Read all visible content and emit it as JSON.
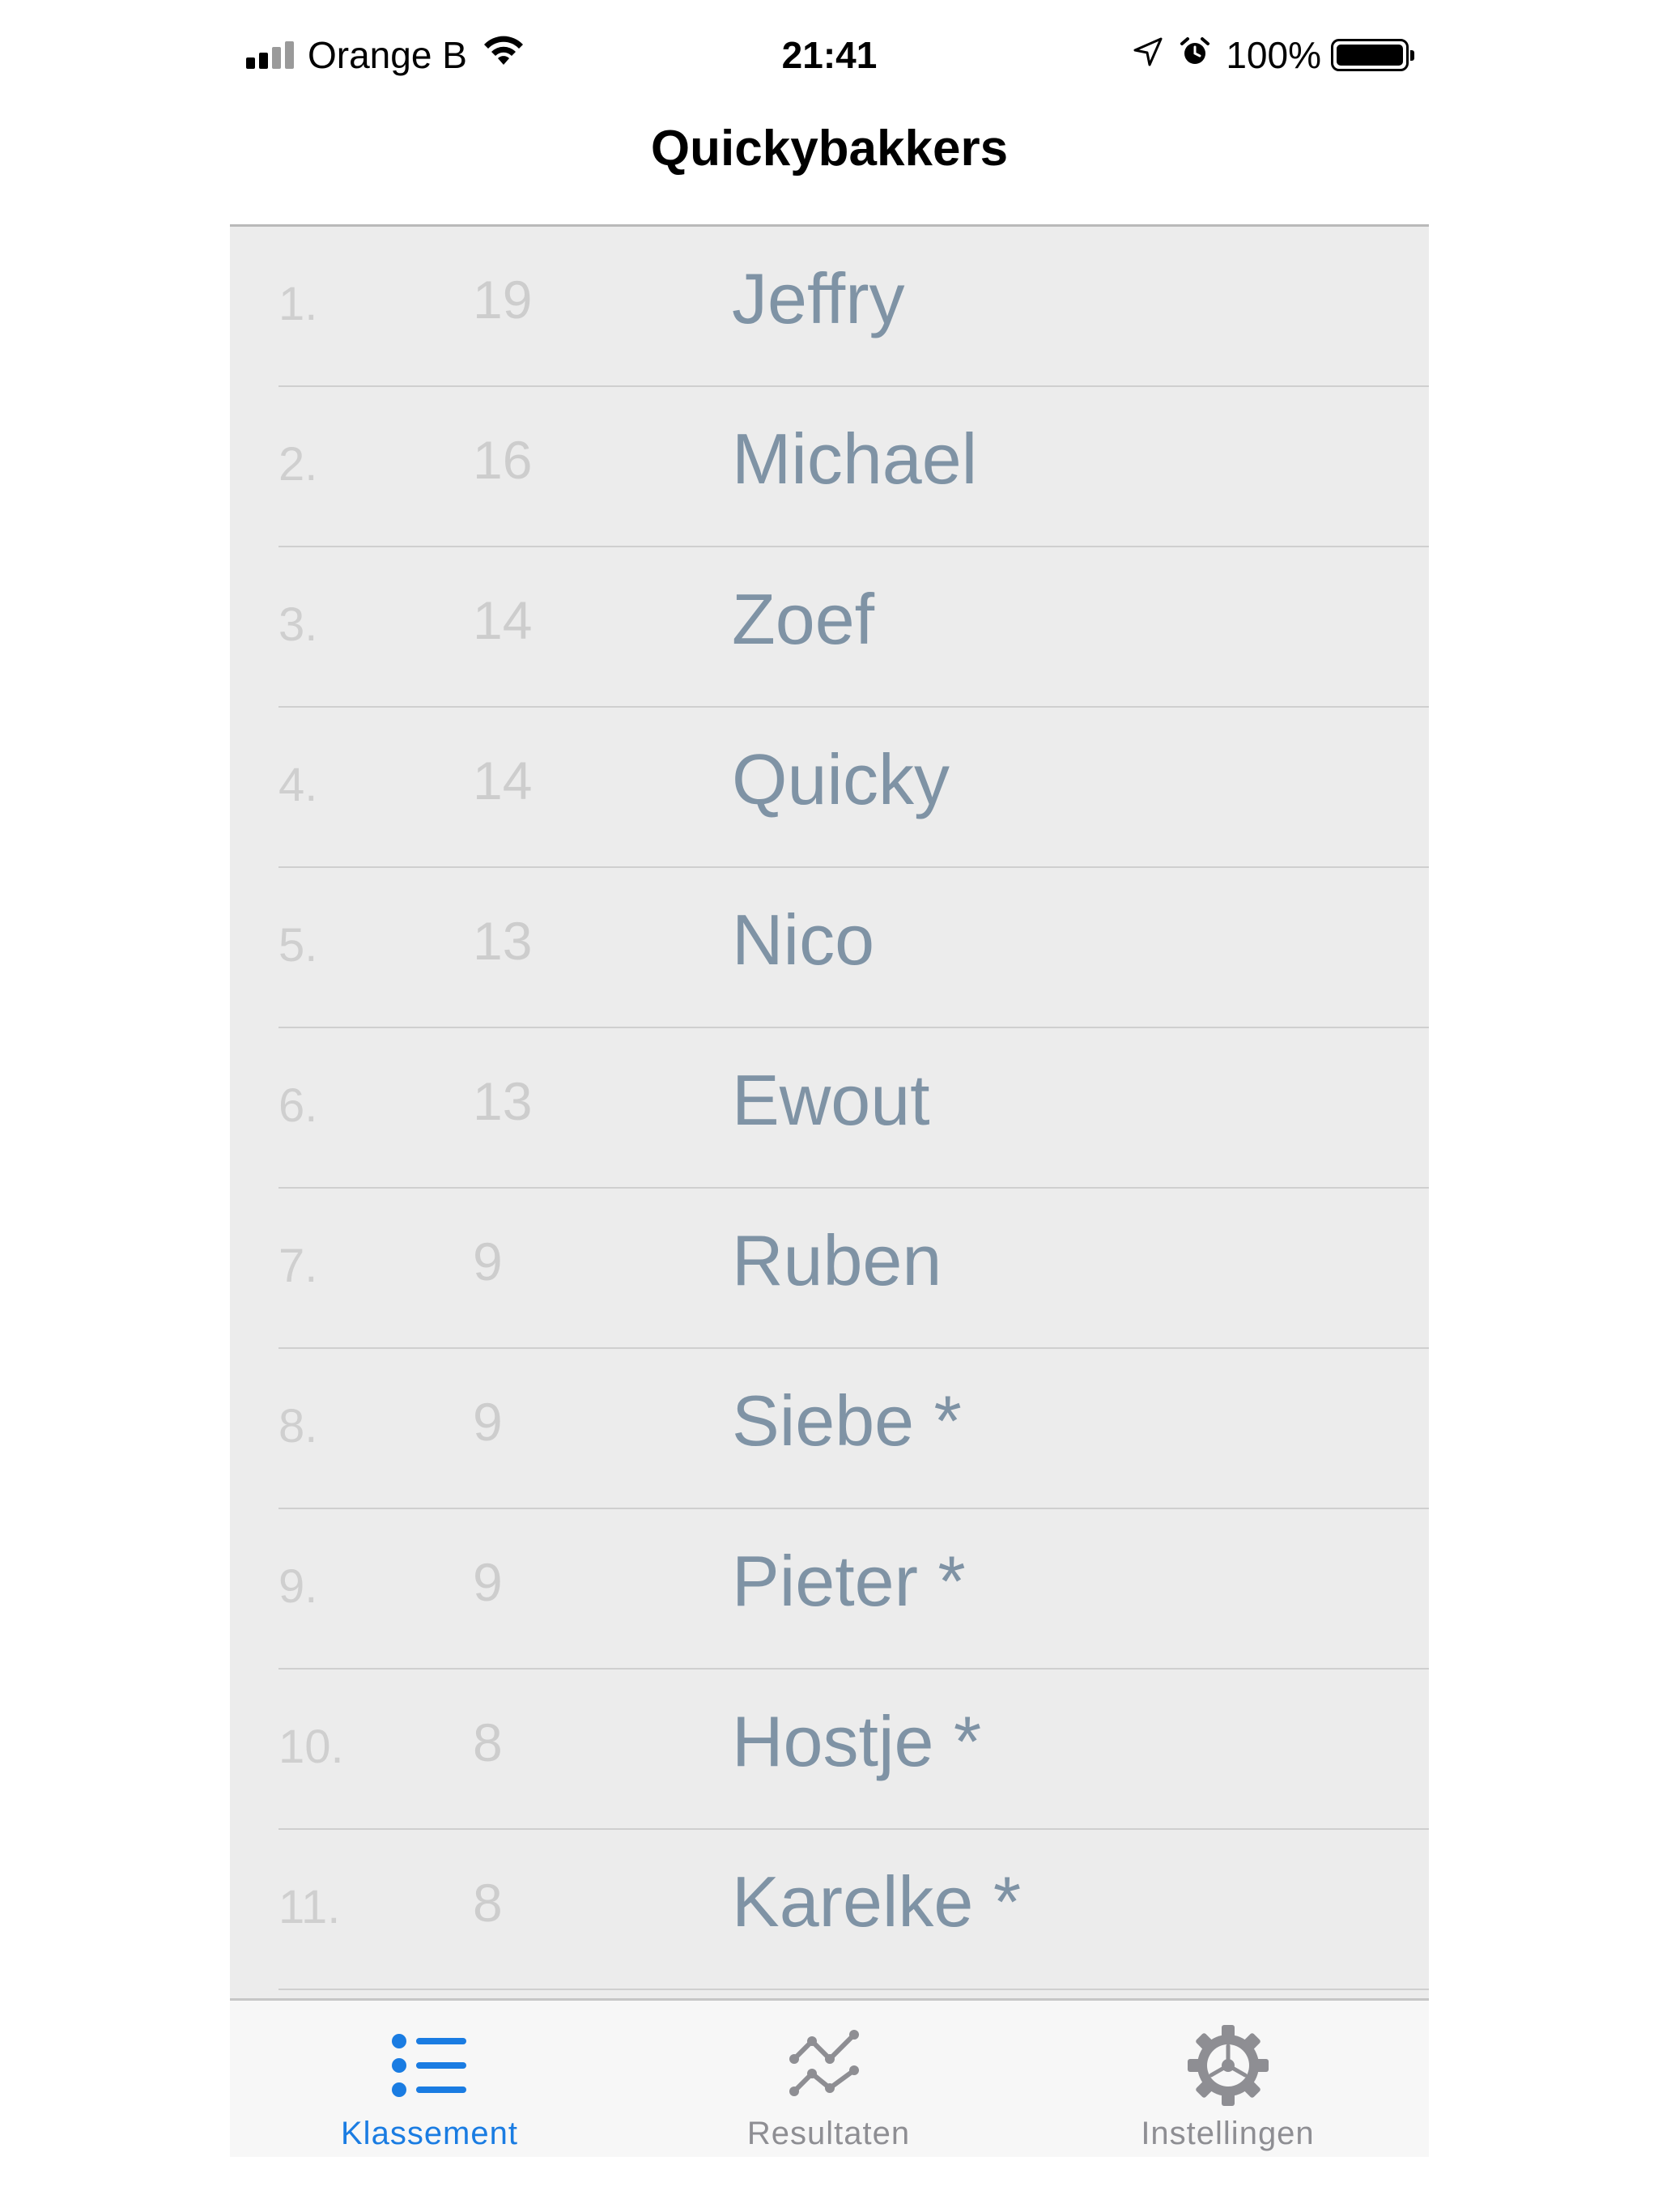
{
  "status_bar": {
    "carrier": "Orange B",
    "time": "21:41",
    "battery": "100%",
    "icons": [
      "signal-icon",
      "wifi-icon",
      "location-arrow-icon",
      "alarm-icon",
      "battery-icon"
    ]
  },
  "nav": {
    "title": "Quickybakkers"
  },
  "ranking": {
    "rows": [
      {
        "rank": "1.",
        "score": "19",
        "name": "Jeffry"
      },
      {
        "rank": "2.",
        "score": "16",
        "name": "Michael"
      },
      {
        "rank": "3.",
        "score": "14",
        "name": "Zoef"
      },
      {
        "rank": "4.",
        "score": "14",
        "name": "Quicky"
      },
      {
        "rank": "5.",
        "score": "13",
        "name": "Nico"
      },
      {
        "rank": "6.",
        "score": "13",
        "name": "Ewout"
      },
      {
        "rank": "7.",
        "score": "9",
        "name": "Ruben"
      },
      {
        "rank": "8.",
        "score": "9",
        "name": "Siebe *"
      },
      {
        "rank": "9.",
        "score": "9",
        "name": "Pieter *"
      },
      {
        "rank": "10.",
        "score": "8",
        "name": "Hostje *"
      },
      {
        "rank": "11.",
        "score": "8",
        "name": "Karelke *"
      }
    ]
  },
  "tabs": [
    {
      "label": "Klassement",
      "icon": "list-icon",
      "active": true
    },
    {
      "label": "Resultaten",
      "icon": "chart-line-icon",
      "active": false
    },
    {
      "label": "Instellingen",
      "icon": "gear-icon",
      "active": false
    }
  ],
  "colors": {
    "accent": "#1a7ce2",
    "inactive_tab": "#8e8e93",
    "list_bg": "#ececec",
    "name_text": "#7f93a5"
  }
}
